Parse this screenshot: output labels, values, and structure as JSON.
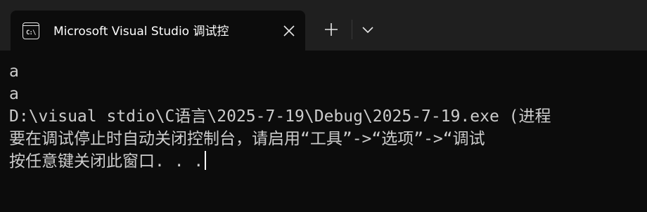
{
  "window": {
    "tab": {
      "icon": "console-icon",
      "icon_glyph": "C:\\",
      "title": "Microsoft Visual Studio 调试控"
    },
    "buttons": {
      "close": "close-icon",
      "new_tab": "plus-icon",
      "dropdown": "chevron-down-icon"
    }
  },
  "console": {
    "lines": [
      "a",
      "a",
      "D:\\visual stdio\\C语言\\2025-7-19\\Debug\\2025-7-19.exe (进程",
      "要在调试停止时自动关闭控制台，请启用“工具”->“选项”->“调试",
      "按任意键关闭此窗口. . ."
    ]
  },
  "colors": {
    "background": "#0c0c0c",
    "titlebar": "#1f1f1f",
    "text": "#cccccc"
  }
}
